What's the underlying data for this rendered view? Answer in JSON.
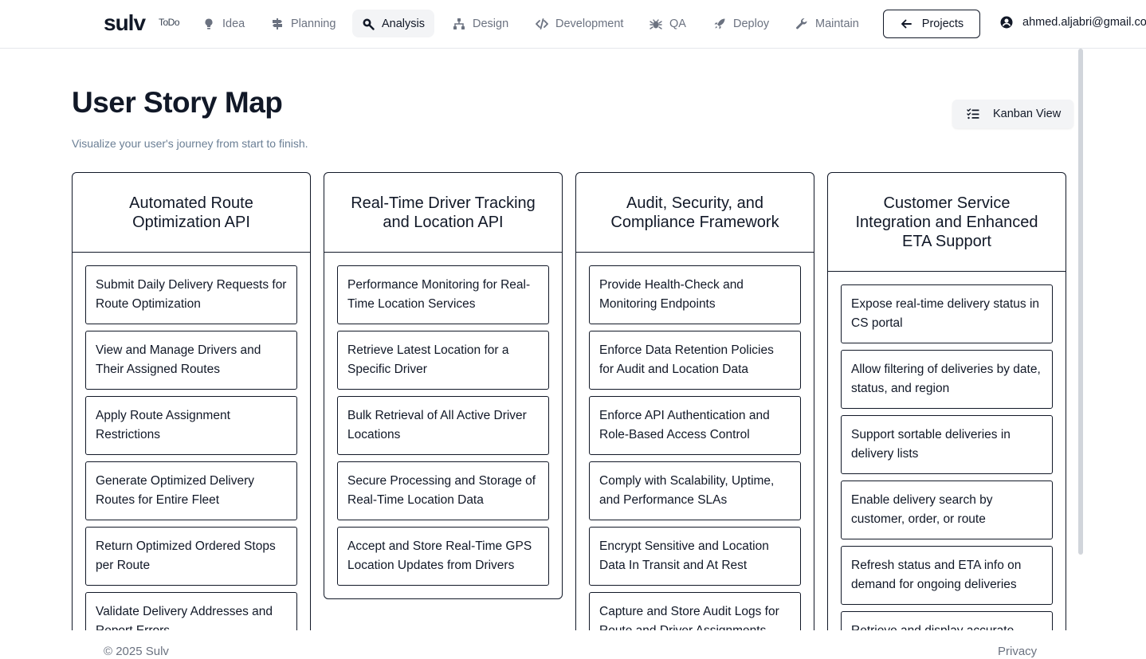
{
  "nav": {
    "logo": "sulv",
    "todo": "ToDo",
    "items": [
      {
        "label": "Idea",
        "icon": "lightbulb-icon"
      },
      {
        "label": "Planning",
        "icon": "signpost-icon"
      },
      {
        "label": "Analysis",
        "icon": "search-icon",
        "active": true
      },
      {
        "label": "Design",
        "icon": "sitemap-icon"
      },
      {
        "label": "Development",
        "icon": "code-icon"
      },
      {
        "label": "QA",
        "icon": "bug-icon"
      },
      {
        "label": "Deploy",
        "icon": "rocket-icon"
      },
      {
        "label": "Maintain",
        "icon": "wrench-icon"
      }
    ],
    "projects_label": "Projects",
    "user_email": "ahmed.aljabri@gmail.co"
  },
  "header": {
    "title": "User Story Map",
    "subtitle": "Visualize your user's journey from start to finish.",
    "kanban_label": "Kanban View"
  },
  "columns": [
    {
      "title": "Automated Route Optimization API",
      "stories": [
        "Submit Daily Delivery Requests for Route Optimization",
        "View and Manage Drivers and Their Assigned Routes",
        "Apply Route Assignment Restrictions",
        "Generate Optimized Delivery Routes for Entire Fleet",
        "Return Optimized Ordered Stops per Route",
        "Validate Delivery Addresses and Report Errors"
      ]
    },
    {
      "title": "Real-Time Driver Tracking and Location API",
      "stories": [
        "Performance Monitoring for Real-Time Location Services",
        "Retrieve Latest Location for a Specific Driver",
        "Bulk Retrieval of All Active Driver Locations",
        "Secure Processing and Storage of Real-Time Location Data",
        "Accept and Store Real-Time GPS Location Updates from Drivers"
      ]
    },
    {
      "title": "Audit, Security, and Compliance Framework",
      "stories": [
        "Provide Health-Check and Monitoring Endpoints",
        "Enforce Data Retention Policies for Audit and Location Data",
        "Enforce API Authentication and Role-Based Access Control",
        "Comply with Scalability, Uptime, and Performance SLAs",
        "Encrypt Sensitive and Location Data In Transit and At Rest",
        "Capture and Store Audit Logs for Route and Driver Assignments"
      ]
    },
    {
      "title": "Customer Service Integration and Enhanced ETA Support",
      "stories": [
        "Expose real-time delivery status in CS portal",
        "Allow filtering of deliveries by date, status, and region",
        "Support sortable deliveries in delivery lists",
        "Enable delivery search by customer, order, or route",
        "Refresh status and ETA info on demand for ongoing deliveries",
        "Retrieve and display accurate"
      ]
    }
  ],
  "footer": {
    "copyright": "© 2025 Sulv",
    "privacy": "Privacy"
  }
}
